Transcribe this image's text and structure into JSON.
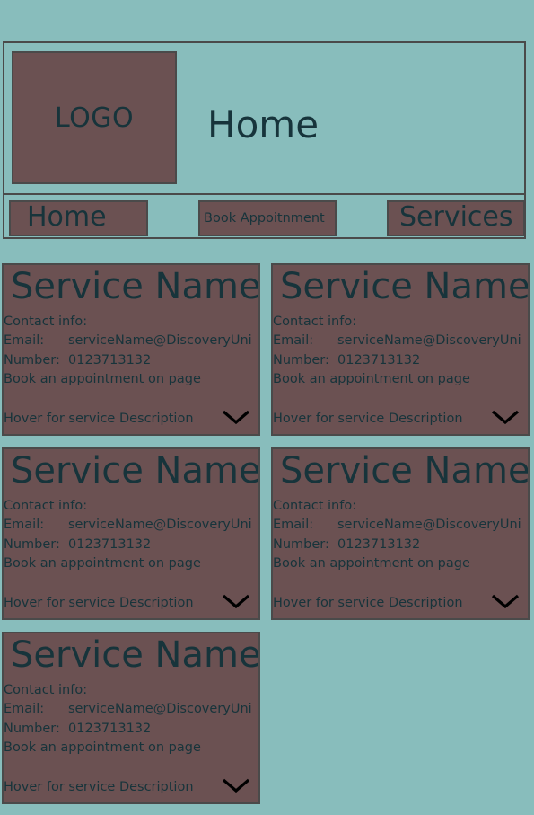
{
  "header": {
    "logo_text": "LOGO",
    "page_title": "Home"
  },
  "nav": {
    "home_label": "Home",
    "book_label": "Book Appoitnment",
    "services_label": "Services"
  },
  "cards": [
    {
      "title": "Service Name",
      "contact_label": "Contact info:",
      "email_key": "Email:",
      "email_value": "serviceName@DiscoveryUni",
      "number_key": "Number:",
      "number_value": "0123713132",
      "book_text": "Book an appointment on page",
      "hover_text": "Hover for service Description"
    },
    {
      "title": "Service Name",
      "contact_label": "Contact info:",
      "email_key": "Email:",
      "email_value": "serviceName@DiscoveryUni",
      "number_key": "Number:",
      "number_value": "0123713132",
      "book_text": "Book an appointment on page",
      "hover_text": "Hover for service Description"
    },
    {
      "title": "Service Name",
      "contact_label": "Contact info:",
      "email_key": "Email:",
      "email_value": "serviceName@DiscoveryUni",
      "number_key": "Number:",
      "number_value": "0123713132",
      "book_text": "Book an appointment on page",
      "hover_text": "Hover for service Description"
    },
    {
      "title": "Service Name",
      "contact_label": "Contact info:",
      "email_key": "Email:",
      "email_value": "serviceName@DiscoveryUni",
      "number_key": "Number:",
      "number_value": "0123713132",
      "book_text": "Book an appointment on page",
      "hover_text": "Hover for service Description"
    },
    {
      "title": "Service Name",
      "contact_label": "Contact info:",
      "email_key": "Email:",
      "email_value": "serviceName@DiscoveryUni",
      "number_key": "Number:",
      "number_value": "0123713132",
      "book_text": "Book an appointment on page",
      "hover_text": "Hover for service Description"
    }
  ],
  "colors": {
    "background": "#88bdbc",
    "box_fill": "#6b5152",
    "border": "#4a4a4a",
    "text": "#17343b"
  },
  "icons": {
    "expand": "chevron-down-icon"
  }
}
